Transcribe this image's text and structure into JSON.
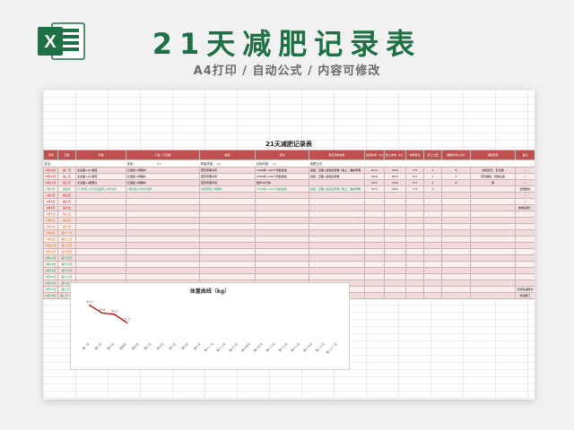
{
  "banner": {
    "logo_letter": "X",
    "title": "21天减肥记录表",
    "subtitle": "A4打印 / 自动公式 / 内容可修改"
  },
  "sheet": {
    "title": "21天减肥记录表",
    "info": [
      {
        "label": "姓名：",
        "value": ""
      },
      {
        "label": "身高：",
        "value": "cm"
      },
      {
        "label": "原始体重：",
        "value": "kg"
      },
      {
        "label": "目标体重：",
        "value": "kg"
      },
      {
        "label": "减肥日志：",
        "value": ""
      }
    ],
    "headers": [
      "日期",
      "天数",
      "早餐",
      "午餐 / 午加餐",
      "晚餐",
      "运动",
      "每日早晚体重",
      "晨起体重（kg）",
      "晚上体重（kg）",
      "体重变化",
      "早上大便",
      "睡眠时间(小时)",
      "减肥感受",
      "备注"
    ],
    "rows": [
      {
        "date": "8月29日",
        "day": "第一天",
        "c2": "全麦面+1小番茄",
        "c3": "红薯饭+鸡胸肉",
        "c4": "西芹拌黑木耳",
        "c5": "1500步+100个仰卧起坐",
        "c6": "晨起：空腹+晨尿后称重 / 晚上：睡前称重",
        "c7": "61.3",
        "c8": "59.6",
        "c9": "1.5",
        "c10": "1",
        "c11": "5",
        "c12": "感觉还行，有点饿",
        "c13": "/",
        "style": "red"
      },
      {
        "date": "8月30日",
        "day": "第二天",
        "c2": "全麦面+1小番茄",
        "c3": "红薯饭+鸡胸肉",
        "c4": "西芹拌黑木耳",
        "c5": "1500步+100个仰卧起坐",
        "c6": "晨起：空腹+晨尿后称重",
        "c7": "59.6",
        "c8": "60.3",
        "c9": "0.3",
        "c10": "1",
        "c11": "7",
        "c12": "有饥饿感，轻微头晕",
        "c13": "/",
        "style": "red"
      },
      {
        "date": "8月31日",
        "day": "第三天",
        "c2": "全麦面+1根黄瓜",
        "c3": "红薯饭+鸡胸肉",
        "c4": "西芹拌黑木耳",
        "c5": "散步40分钟",
        "c6": "",
        "c7": "59.3",
        "c8": "59.6",
        "c9": "0.3",
        "c10": "1",
        "c11": "8",
        "c12": "饿",
        "c13": "/",
        "style": "red"
      },
      {
        "date": "9月1日",
        "day": "第四天",
        "c2": "1个鸡蛋+1片全麦面包+1杯牛奶",
        "c3": "1碗米饭+1份炒青菜",
        "c4": "水煮蔬菜+鸡胸肉",
        "c5": "1500步+100个仰卧起坐",
        "c6": "晨起：空腹+晨尿后称重 / 晚上：睡前称重",
        "c7": "57.5",
        "c8": "58.5",
        "c9": "-0.5",
        "c10": "3",
        "c11": "",
        "c12": "",
        "c13": "感觉很好",
        "style": "green"
      },
      {
        "date": "9月2日",
        "day": "第五天",
        "c2": "",
        "c3": "",
        "c4": "",
        "c5": "",
        "c6": "",
        "c7": "",
        "c8": "",
        "c9": "",
        "c10": "",
        "c11": "",
        "c12": "",
        "c13": "/",
        "style": "red"
      },
      {
        "date": "9月3日",
        "day": "第六天",
        "c2": "",
        "c3": "",
        "c4": "",
        "c5": "",
        "c6": "",
        "c7": "",
        "c8": "",
        "c9": "",
        "c10": "",
        "c11": "",
        "c12": "",
        "c13": "/",
        "style": "red"
      },
      {
        "date": "9月4日",
        "day": "第七天",
        "c2": "",
        "c3": "",
        "c4": "",
        "c5": "",
        "c6": "",
        "c7": "",
        "c8": "",
        "c9": "",
        "c10": "",
        "c11": "",
        "c12": "",
        "c13": "体重反弹了",
        "style": "red"
      },
      {
        "date": "9月5日",
        "day": "第八天",
        "c2": "",
        "c3": "",
        "c4": "",
        "c5": "",
        "c6": "",
        "c7": "",
        "c8": "",
        "c9": "",
        "c10": "",
        "c11": "",
        "c12": "",
        "c13": "",
        "style": "orange"
      },
      {
        "date": "9月6日",
        "day": "第九天",
        "c2": "",
        "c3": "",
        "c4": "",
        "c5": "",
        "c6": "",
        "c7": "",
        "c8": "",
        "c9": "",
        "c10": "",
        "c11": "",
        "c12": "",
        "c13": "",
        "style": "orange"
      },
      {
        "date": "9月7日",
        "day": "第十天",
        "c2": "",
        "c3": "",
        "c4": "",
        "c5": "",
        "c6": "",
        "c7": "",
        "c8": "",
        "c9": "",
        "c10": "",
        "c11": "",
        "c12": "",
        "c13": "",
        "style": "orange"
      },
      {
        "date": "9月8日",
        "day": "第十一天",
        "c2": "",
        "c3": "",
        "c4": "",
        "c5": "",
        "c6": "",
        "c7": "",
        "c8": "",
        "c9": "",
        "c10": "",
        "c11": "",
        "c12": "",
        "c13": "",
        "style": "orange"
      },
      {
        "date": "9月9日",
        "day": "第十二天",
        "c2": "",
        "c3": "",
        "c4": "",
        "c5": "",
        "c6": "",
        "c7": "",
        "c8": "",
        "c9": "",
        "c10": "",
        "c11": "",
        "c12": "",
        "c13": "",
        "style": "orange"
      },
      {
        "date": "9月10日",
        "day": "第十三天",
        "c2": "",
        "c3": "",
        "c4": "",
        "c5": "",
        "c6": "",
        "c7": "",
        "c8": "",
        "c9": "",
        "c10": "",
        "c11": "",
        "c12": "",
        "c13": "",
        "style": "orange"
      },
      {
        "date": "9月11日",
        "day": "第十四天",
        "c2": "",
        "c3": "",
        "c4": "",
        "c5": "",
        "c6": "",
        "c7": "",
        "c8": "",
        "c9": "",
        "c10": "",
        "c11": "",
        "c12": "",
        "c13": "",
        "style": "orange"
      },
      {
        "date": "9月12日",
        "day": "第十五天",
        "c2": "",
        "c3": "",
        "c4": "",
        "c5": "",
        "c6": "",
        "c7": "",
        "c8": "",
        "c9": "",
        "c10": "",
        "c11": "",
        "c12": "",
        "c13": "",
        "style": "green"
      },
      {
        "date": "9月13日",
        "day": "第十六天",
        "c2": "",
        "c3": "",
        "c4": "",
        "c5": "",
        "c6": "",
        "c7": "",
        "c8": "",
        "c9": "",
        "c10": "",
        "c11": "",
        "c12": "",
        "c13": "",
        "style": "green"
      },
      {
        "date": "9月14日",
        "day": "第十七天",
        "c2": "",
        "c3": "",
        "c4": "",
        "c5": "",
        "c6": "",
        "c7": "",
        "c8": "",
        "c9": "",
        "c10": "",
        "c11": "",
        "c12": "",
        "c13": "",
        "style": "green"
      },
      {
        "date": "9月15日",
        "day": "第十八天",
        "c2": "",
        "c3": "",
        "c4": "",
        "c5": "",
        "c6": "",
        "c7": "",
        "c8": "",
        "c9": "",
        "c10": "",
        "c11": "",
        "c12": "",
        "c13": "",
        "style": "green"
      },
      {
        "date": "9月16日",
        "day": "第十九天",
        "c2": "",
        "c3": "",
        "c4": "",
        "c5": "",
        "c6": "",
        "c7": "",
        "c8": "",
        "c9": "",
        "c10": "",
        "c11": "",
        "c12": "",
        "c13": "",
        "style": "green"
      },
      {
        "date": "9月17日",
        "day": "第二十天",
        "c2": "",
        "c3": "",
        "c4": "",
        "c5": "",
        "c6": "",
        "c7": "",
        "c8": "",
        "c9": "",
        "c10": "",
        "c11": "",
        "c12": "",
        "c13": "坚持就是胜利",
        "style": "green"
      },
      {
        "date": "9月18日",
        "day": "第二十一天",
        "c2": "",
        "c3": "",
        "c4": "",
        "c5": "",
        "c6": "",
        "c7": "",
        "c8": "",
        "c9": "",
        "c10": "",
        "c11": "",
        "c12": "",
        "c13": "成功瘦了",
        "style": "green"
      }
    ]
  },
  "chart_data": {
    "type": "line",
    "title": "体重曲线（kg）",
    "categories": [
      "第一天",
      "第二天",
      "第三天",
      "第四天",
      "第五天",
      "第六天",
      "第七天",
      "第八天",
      "第九天",
      "第十天",
      "第十一天",
      "第十二天",
      "第十三天",
      "第十四天",
      "第十五天",
      "第十六天",
      "第十七天",
      "第十八天",
      "第十九天",
      "第二十天",
      "第二十一天"
    ],
    "series": [
      {
        "values": [
          61.3,
          59.6,
          59.3,
          57.5
        ]
      }
    ],
    "data_labels": [
      "61.3",
      "59.6",
      "59.3",
      "57.5"
    ],
    "ylim": [
      54,
      63
    ],
    "grid": false,
    "color": "#c00000"
  }
}
